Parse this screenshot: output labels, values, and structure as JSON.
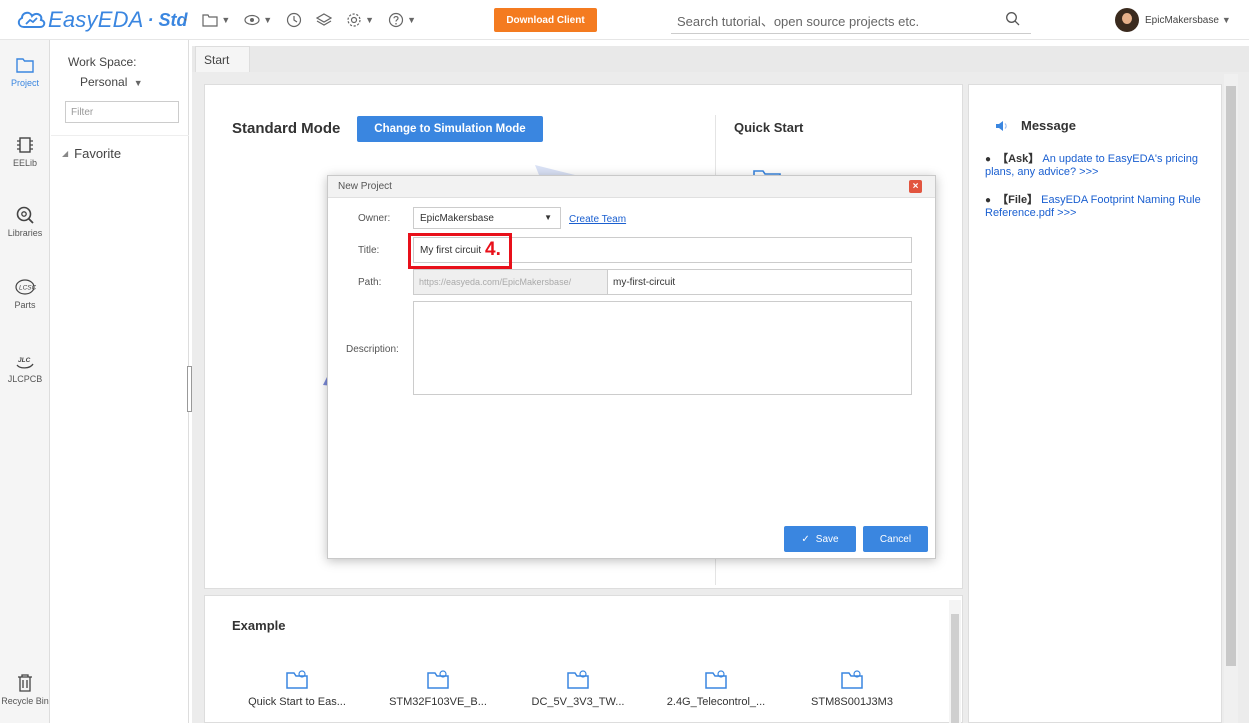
{
  "app": {
    "name": "EasyEDA",
    "edition": "Std",
    "download_label": "Download Client",
    "search_placeholder": "Search tutorial、open source projects etc.",
    "username": "EpicMakersbase"
  },
  "iconbar": [
    {
      "label": "Project",
      "icon": "folder-icon",
      "active": true
    },
    {
      "label": "EELib",
      "icon": "chip-icon"
    },
    {
      "label": "Libraries",
      "icon": "magnifier-icon"
    },
    {
      "label": "Parts",
      "icon": "lcsc-icon"
    },
    {
      "label": "JLCPCB",
      "icon": "jlc-icon"
    },
    {
      "label": "Recycle Bin",
      "icon": "trash-icon"
    }
  ],
  "workspace": {
    "label": "Work Space:",
    "value": "Personal",
    "filter_placeholder": "Filter",
    "favorite": "Favorite"
  },
  "tabs": [
    {
      "label": "Start"
    }
  ],
  "start": {
    "mode_title": "Standard Mode",
    "switch_button": "Change to Simulation Mode",
    "quick_start": "Quick Start"
  },
  "message": {
    "title": "Message",
    "items": [
      {
        "tag": "【Ask】",
        "text": "An update to EasyEDA's pricing plans, any advice? >>>"
      },
      {
        "tag": "【File】",
        "text": "EasyEDA Footprint Naming Rule Reference.pdf >>>"
      }
    ]
  },
  "example": {
    "title": "Example",
    "items": [
      {
        "label": "Quick Start to Eas..."
      },
      {
        "label": "STM32F103VE_B..."
      },
      {
        "label": "DC_5V_3V3_TW..."
      },
      {
        "label": "2.4G_Telecontrol_..."
      },
      {
        "label": "STM8S001J3M3"
      }
    ]
  },
  "dialog": {
    "title": "New Project",
    "owner_label": "Owner:",
    "owner_value": "EpicMakersbase",
    "create_team": "Create Team",
    "title_label": "Title:",
    "title_value": "My first circuit",
    "path_label": "Path:",
    "path_prefix": "https://easyeda.com/EpicMakersbase/",
    "path_value": "my-first-circuit",
    "description_label": "Description:",
    "save": "Save",
    "cancel": "Cancel",
    "callout_number": "4."
  },
  "colors": {
    "brand": "#3a86e0",
    "download": "#f47b20",
    "callout": "#e8101a",
    "close": "#e2553f"
  }
}
